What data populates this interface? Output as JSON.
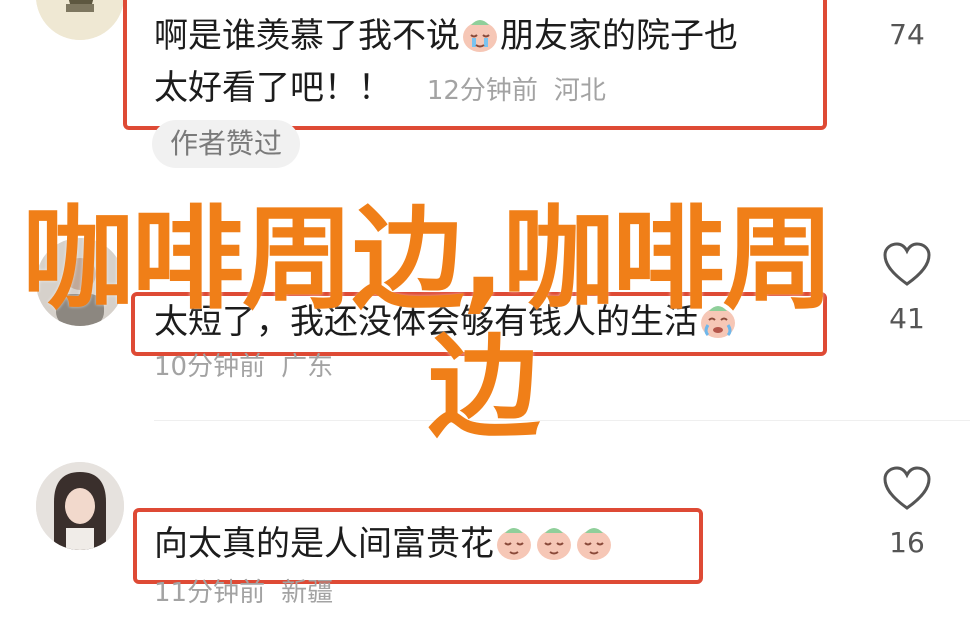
{
  "comments": [
    {
      "text_line1": "啊是谁羡慕了我不说",
      "text_line1b": "朋友家的院子也",
      "text_line2": "太好看了吧！！",
      "time": "12分钟前",
      "location": "河北",
      "likes": "74",
      "badge": "作者赞过"
    },
    {
      "text": "太短了，我还没体会够有钱人的生活",
      "time": "10分钟前",
      "location": "广东",
      "likes": "41"
    },
    {
      "text": "向太真的是人间富贵花",
      "time": "11分钟前",
      "location": "新疆",
      "likes": "16"
    }
  ],
  "watermark": {
    "line1": "咖啡周边,咖啡周",
    "line2": "边"
  },
  "colors": {
    "highlight_box": "#de4a35",
    "watermark": "#f07f18"
  },
  "icons": [
    "heart-icon",
    "pensive-emoji-icon",
    "crying-emoji-icon"
  ]
}
